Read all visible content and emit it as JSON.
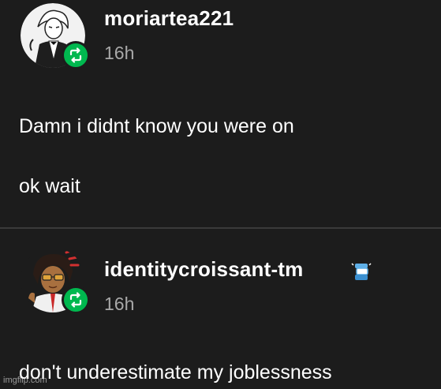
{
  "posts": [
    {
      "username": "moriartea221",
      "timestamp": "16h",
      "avatar_icon": "butler-portrait-avatar",
      "status_icon": "reblog-icon",
      "body": [
        "Damn i didnt know you were on",
        "ok wait"
      ]
    },
    {
      "username": "identitycroissant-tm",
      "timestamp": "16h",
      "avatar_icon": "character-portrait-avatar",
      "status_icon": "reblog-icon",
      "extra_icon": "sticker-badge-icon",
      "body": [
        "don't underestimate my joblessness"
      ]
    }
  ],
  "watermark": "imgflip.com",
  "colors": {
    "background": "#1c1c1c",
    "reblog_green": "#00b84f",
    "timestamp_gray": "#a8a8a8",
    "divider": "#3a3a3a"
  }
}
